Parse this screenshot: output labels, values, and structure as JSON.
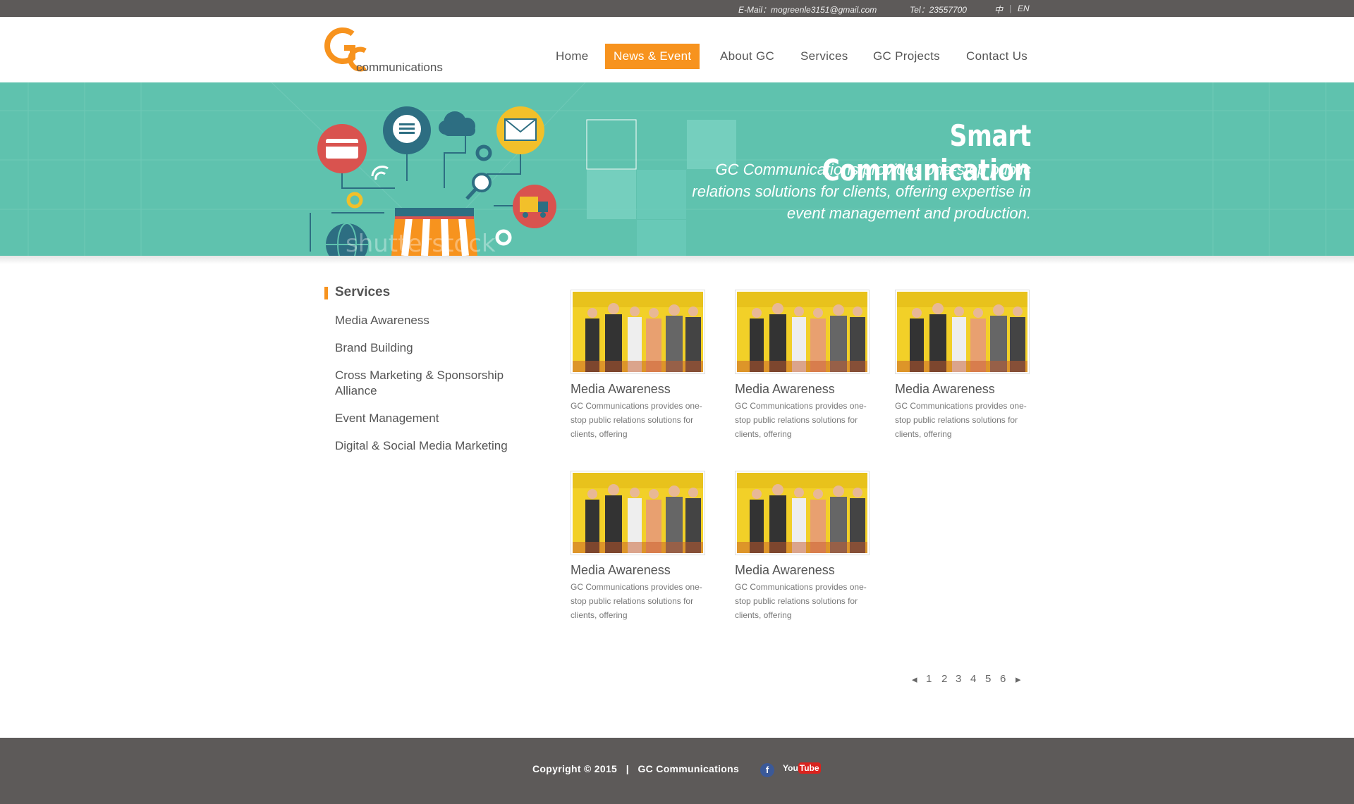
{
  "topbar": {
    "email": "E-Mail：mogreenle3151@gmail.com",
    "tel": "Tel：23557700",
    "lang_zh": "中",
    "lang_sep": "|",
    "lang_en": "EN"
  },
  "header": {
    "logo_text": "communications",
    "nav": [
      "Home",
      "News & Event",
      "About GC",
      "Services",
      "GC Projects",
      "Contact Us"
    ],
    "active_nav": "News & Event"
  },
  "banner": {
    "title": "Smart Communication",
    "description": "GC Communications provides one-stop public relations solutions for clients, offering expertise in event management and production.",
    "watermark": "shutterstock"
  },
  "sidebar": {
    "heading": "Services",
    "items": [
      {
        "label": "Media Awareness"
      },
      {
        "label": "Brand Building"
      },
      {
        "label": "Cross Marketing & Sponsorship Alliance"
      },
      {
        "label": "Event Management"
      },
      {
        "label": "Digital & Social Media Marketing"
      }
    ]
  },
  "cards": [
    {
      "title": "Media Awareness",
      "desc": "GC Communications provides one-stop public relations solutions for clients, offering"
    },
    {
      "title": "Media Awareness",
      "desc": "GC Communications provides one-stop public relations solutions for clients, offering"
    },
    {
      "title": "Media Awareness",
      "desc": "GC Communications provides one-stop public relations solutions for clients, offering"
    },
    {
      "title": "Media Awareness",
      "desc": "GC Communications provides one-stop public relations solutions for clients, offering"
    },
    {
      "title": "Media Awareness",
      "desc": "GC Communications provides one-stop public relations solutions for clients, offering"
    }
  ],
  "pagination": {
    "prev_icon": "triangle-left-icon",
    "pages": [
      "1",
      "2",
      "3",
      "4",
      "5",
      "6"
    ],
    "next_icon": "triangle-right-icon"
  },
  "footer": {
    "copyright": "Copyright © 2015   |   GC Communications",
    "facebook_icon": "f",
    "youtube_you": "You",
    "youtube_tube": "Tube"
  },
  "colors": {
    "accent": "#f7931e",
    "banner": "#5fc2ae",
    "dark_bar": "#5d5a59"
  }
}
